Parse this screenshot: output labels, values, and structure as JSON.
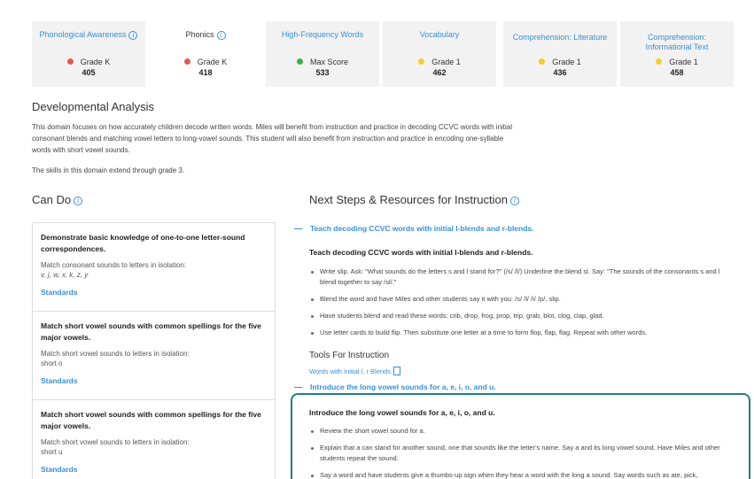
{
  "score_cards": [
    {
      "title": "Phonological Awareness",
      "info": true,
      "grade": "Grade K",
      "score": "405",
      "dot_color": "#e05a5a",
      "style": "shaded",
      "title_color": "blue"
    },
    {
      "title": "Phonics",
      "info": true,
      "grade": "Grade K",
      "score": "418",
      "dot_color": "#e05a5a",
      "style": "plain",
      "title_color": "dark"
    },
    {
      "title": "High-Frequency Words",
      "info": false,
      "grade": "Max Score",
      "score": "533",
      "dot_color": "#3fae49",
      "style": "shaded",
      "title_color": "blue"
    },
    {
      "title": "Vocabulary",
      "info": false,
      "grade": "Grade 1",
      "score": "462",
      "dot_color": "#f2cf2c",
      "style": "shaded",
      "title_color": "blue"
    },
    {
      "title": "Comprehension: Literature",
      "info": false,
      "grade": "Grade 1",
      "score": "436",
      "dot_color": "#f2cf2c",
      "style": "shaded",
      "title_color": "blue"
    },
    {
      "title": "Comprehension: Informational Text",
      "info": false,
      "grade": "Grade 1",
      "score": "458",
      "dot_color": "#f2cf2c",
      "style": "shaded",
      "title_color": "blue"
    }
  ],
  "developmental": {
    "title": "Developmental Analysis",
    "text": "This domain focuses on how accurately children decode written words. Miles will benefit from instruction and practice in decoding CCVC words with initial consonant blends and matching vowel letters to long-vowel sounds. This student will also benefit from instruction and practice in encoding one-syllable words with short vowel sounds.",
    "extend": "The skills in this domain extend through grade 3."
  },
  "can_do": {
    "title": "Can Do",
    "skills": [
      {
        "title": "Demonstrate basic knowledge of one-to-one letter-sound correspondences.",
        "desc": "Match consonant sounds to letters in isolation:",
        "example": "v, j, w, x, k, z, y",
        "italic": true,
        "standards": "Standards"
      },
      {
        "title": "Match short vowel sounds with common spellings for the five major vowels.",
        "desc": "Match short vowel sounds to letters in isolation:",
        "example": "short o",
        "italic": false,
        "standards": "Standards"
      },
      {
        "title": "Match short vowel sounds with common spellings for the five major vowels.",
        "desc": "Match short vowel sounds to letters in isolation:",
        "example": "short u",
        "italic": false,
        "standards": "Standards"
      }
    ]
  },
  "next_steps": {
    "title": "Next Steps & Resources for Instruction",
    "section1": {
      "head": "Teach decoding CCVC words with initial l-blends and r-blends.",
      "instr_title": "Teach decoding CCVC words with initial l-blends and r-blends.",
      "bullets": [
        "Write slip. Ask: \"What sounds do the letters s and l stand for?\" (/s/ /l/) Underline the blend sl. Say: \"The sounds of the consonants s and l blend together to say /sl/.\"",
        "Blend the word and have Miles and other students say it with you: /s/ /l/ /i/ /p/, slip.",
        "Have students blend and read these words: crib, drop, frog, prop, trip, grab, blot, clog, clap, glad.",
        "Use letter cards to build flip. Then substitute one letter at a time to form flop, flap, flag. Repeat with other words."
      ]
    },
    "tools_title": "Tools For Instruction",
    "tool_link": "Words with Initial l, r Blends",
    "section2": {
      "head": "Introduce the long vowel sounds for a, e, i, o, and u.",
      "instr_title": "Introduce the long vowel sounds for a, e, i, o, and u.",
      "bullets": [
        "Review the short vowel sound for a.",
        "Explain that a can stand for another sound, one that sounds like the letter's name. Say a and its long vowel sound. Have Miles and other students repeat the sound.",
        "Say a word and have students give a thumbs-up sign when they hear a word with the long a sound. Say words such as ate, pick,"
      ]
    }
  }
}
